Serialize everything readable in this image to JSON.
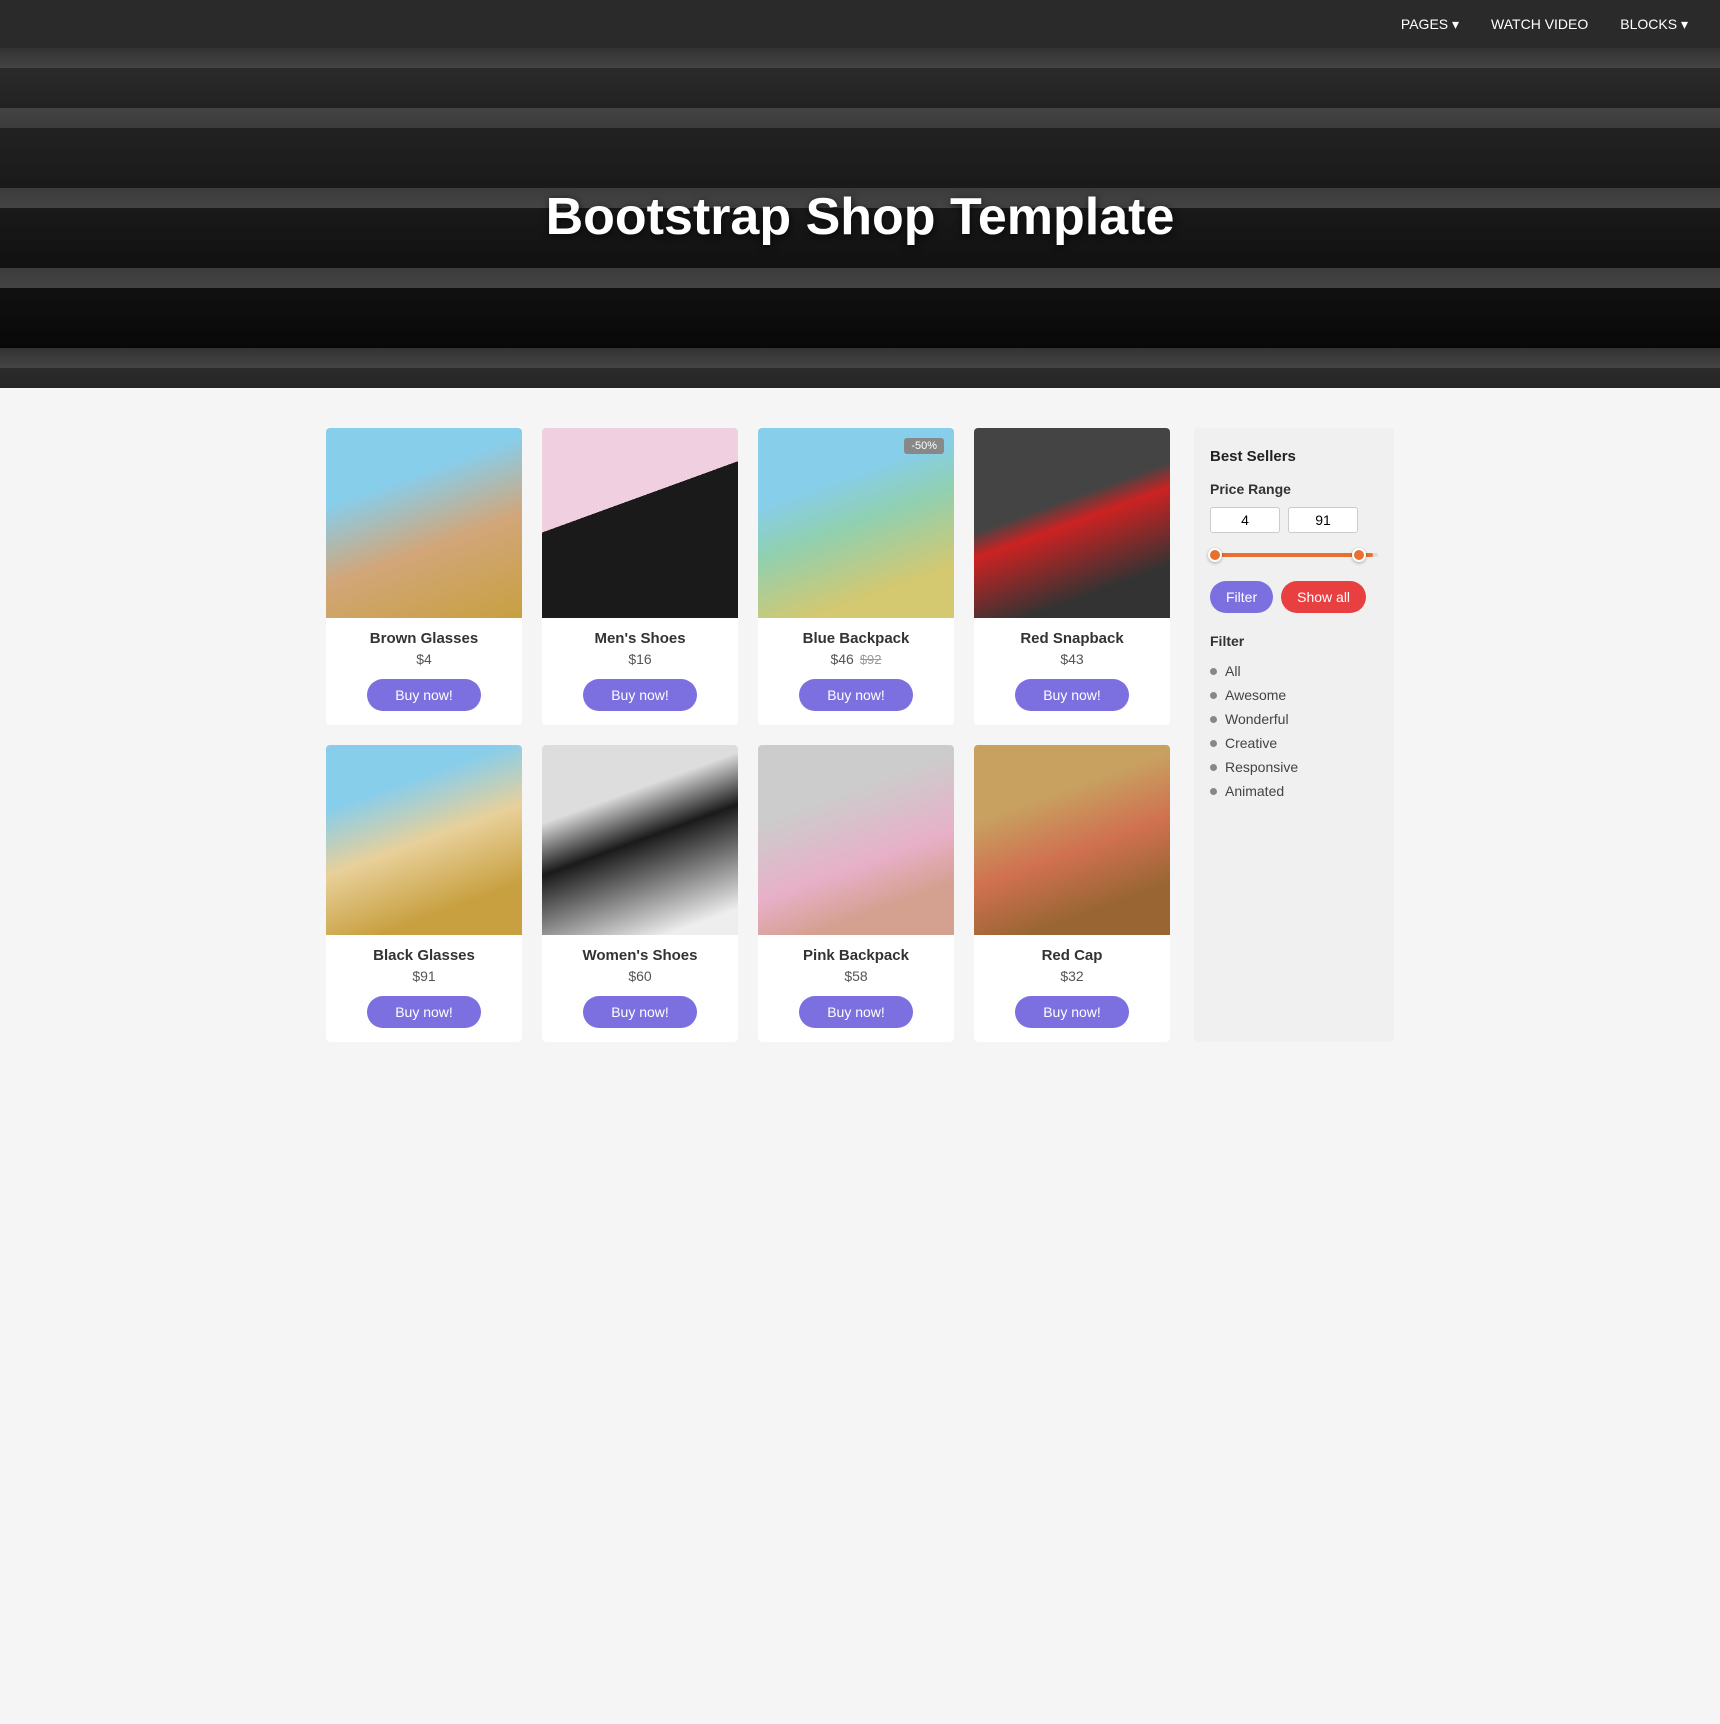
{
  "nav": {
    "items": [
      {
        "label": "PAGES ▾",
        "key": "pages"
      },
      {
        "label": "WATCH VIDEO",
        "key": "watch-video"
      },
      {
        "label": "BLOCKS ▾",
        "key": "blocks"
      }
    ]
  },
  "hero": {
    "title": "Bootstrap Shop Template"
  },
  "sidebar": {
    "section_title": "Best Sellers",
    "price_range_label": "Price Range",
    "price_min": "4",
    "price_max": "91",
    "filter_button": "Filter",
    "show_all_button": "Show all",
    "filter_title": "Filter",
    "filter_items": [
      {
        "label": "All"
      },
      {
        "label": "Awesome"
      },
      {
        "label": "Wonderful"
      },
      {
        "label": "Creative"
      },
      {
        "label": "Responsive"
      },
      {
        "label": "Animated"
      }
    ]
  },
  "products": [
    {
      "id": "brown-glasses",
      "name": "Brown Glasses",
      "price": "$4",
      "original_price": null,
      "badge": null,
      "buy_label": "Buy now!"
    },
    {
      "id": "mens-shoes",
      "name": "Men's Shoes",
      "price": "$16",
      "original_price": null,
      "badge": null,
      "buy_label": "Buy now!"
    },
    {
      "id": "blue-backpack",
      "name": "Blue Backpack",
      "price": "$46",
      "original_price": "$92",
      "badge": "-50%",
      "buy_label": "Buy now!"
    },
    {
      "id": "red-snapback",
      "name": "Red Snapback",
      "price": "$43",
      "original_price": null,
      "badge": null,
      "buy_label": "Buy now!"
    },
    {
      "id": "black-glasses",
      "name": "Black Glasses",
      "price": "$91",
      "original_price": null,
      "badge": null,
      "buy_label": "Buy now!"
    },
    {
      "id": "womens-shoes",
      "name": "Women's Shoes",
      "price": "$60",
      "original_price": null,
      "badge": null,
      "buy_label": "Buy now!"
    },
    {
      "id": "pink-backpack",
      "name": "Pink Backpack",
      "price": "$58",
      "original_price": null,
      "badge": null,
      "buy_label": "Buy now!"
    },
    {
      "id": "red-cap",
      "name": "Red Cap",
      "price": "$32",
      "original_price": null,
      "badge": null,
      "buy_label": "Buy now!"
    }
  ]
}
